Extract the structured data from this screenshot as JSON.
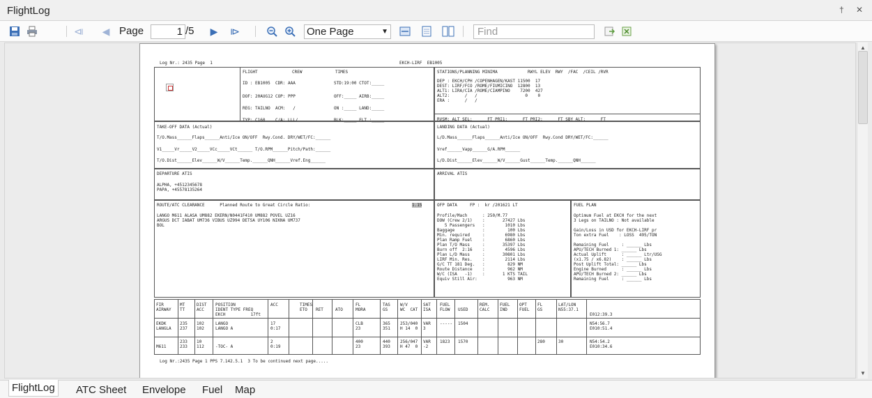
{
  "window": {
    "title": "FlightLog",
    "pin_icon": "pin-icon",
    "close_icon": "close-icon"
  },
  "toolbar": {
    "page_label": "Page",
    "page_value": "1",
    "page_total": "/5",
    "zoom_value": "One Page",
    "find_placeholder": "Find",
    "icons": [
      "save-icon",
      "print-icon",
      "first-page-icon",
      "previous-page-icon",
      "next-page-icon",
      "last-page-icon",
      "zoom-out-icon",
      "zoom-in-icon",
      "page-width-icon",
      "single-page-icon",
      "two-page-icon",
      "export-icon",
      "export-excel-icon"
    ]
  },
  "tabs": [
    "FlightLog",
    "ATC Sheet",
    "Envelope",
    "Fuel",
    "Map"
  ],
  "accent_color": "#2a6fd0",
  "doc": {
    "header_left": "Log Nr.: 2435 Page  1",
    "header_center": "EKCH-LIRF  EB1005",
    "col_flight": "FLIGHT",
    "col_crew": "CREW",
    "col_times": "TIMES",
    "id_line": "ID : EB1005  CDR: AAA",
    "dof_line": "DOF: 20AUG12 COP: PPP",
    "reg_line": "REG: TAILNO  ACM:   /",
    "typ_line": "TYP: C160    C/A: LLL/",
    "std_line": "STD:19:00 CTOT:_____",
    "off_line": "OFF:_____ AIRB:_____",
    "on_line": "ON :_____ LAND:_____",
    "blk_line": "BLK:_____ FLT :_____",
    "stations_hdr": "STATIONS/PLANNING MINIMA            RWYL ELEV  RWY  /FAC  /CEIL /RVR",
    "dep_line": "DEP : EKCH/CPH /COPENHAGEN/KAST 11500  17",
    "dest_line": "DEST: LIRF/FCO /ROME/FIUMICINO  12800  13",
    "alt1_line": "ALT1: LIRA/CIA /ROME/CIAMPINO    7200  427",
    "alt2_line": "ALT2:      /   /                   0    0",
    "era_line": "ERA :      /   /",
    "rvsm_line": "RVSM: ALT SEL:______FT PRI1:______FT PRI2:______FT SBY ALT:______FT",
    "to_hdr": "TAKE-OFF DATA (Actual)",
    "to_l1": "T/O.Mass______Flaps______Anti/Ice ON/OFF  Rwy.Cond. DRY/WET/FC:______",
    "to_l2": "V1_____Vr_____V2_____VCc_____VCt______ T/O.RPM______Pitch/Path:______",
    "to_l3": "T/O.Dist______Elev______W/V______Temp.______QNH______Vref.Eng______",
    "ldg_hdr": "LANDING DATA (Actual)",
    "ldg_l1": "L/D.Mass______Flaps______Anti/Ice ON/OFF  Rwy.Cond DRY/WET/FC:______",
    "ldg_l2": "Vref______Vapp______G/A.RPM______",
    "ldg_l3": "L/D.Dist______Elev______W/V______Gust______Temp.______QNH______",
    "dep_atis_hdr": "DEPARTURE ATIS",
    "dep_atis_l1": "ALPHA, +4512345678",
    "dep_atis_l2": "PAPA, +45578135264",
    "arr_atis_hdr": "ARRIVAL ATIS",
    "route_hdr": "ROUTE/ATC CLEARANCE      Planned Route to Great Circle Ratio:",
    "route_ratio": "1.15",
    "route_l1": "LANGO M611 ALASA UM882 EKERN/N0441F410 UM882 POVEL UZ16",
    "route_l2": "ARGUS DCT IABAT UM736 VIBUS UZ994 DETSA UY106 NIKNA UM737",
    "route_l3": "BOL",
    "ofp_hdr": "OFP DATA     FP :  kr /201621 LT",
    "ofp_lines": [
      "Profile/Mach      : 250/M.77",
      "DOW (Crew 2/1)    :       27427 Lbs",
      "   5 Passengers   :        1010 Lbs",
      "Baggage           :         100 Lbs",
      "Min. required     :        6980 Lbs",
      "Plan Ramp Fuel    :        6860 Lbs",
      "Plan T/O Mass     :       35397 Lbs",
      "Burn off  2:16    :        4596 Lbs",
      "Plan L/D Mass     :       30801 Lbs",
      "LIRF Min. Res.    :        2114 Lbs",
      "G/C TT 181 Deg.   :         829 NM",
      "Route Distance    :         962 NM",
      "W/C (ISA   -1)    :       1 KTS TAIL",
      "Equiv Still Air:            963 NM"
    ],
    "fuel_hdr": "FUEL PLAN",
    "fuel_lines": [
      "Optimum Fuel at EKCH for the next",
      "3 Legs on TAILNO : Not available",
      "",
      "Gain/Loss in USD for EKCH-LIRF pr",
      "Ton extra Fuel    : LOSS  495/TON",
      "",
      "Remaining Fuel     : ______ Lbs",
      "APU/TECH Burned 1: ______ Lbs",
      "Actual Uplift      : ______ Ltr/USG",
      "(x1.75 / x6.82)    : ______ Lbs",
      "Post Uplift Total: ______ Lbs",
      "Engine Burned      : ______ Lbs",
      "APU/TECH Burned 2: ______ Lbs",
      "Remaining Fuel     : ______ Lbs"
    ],
    "table_hdr1": [
      "FIR",
      "MT",
      "DIST",
      "POSITION",
      "ACC",
      "TIMES",
      "",
      "",
      "FL",
      "TAS",
      "W/V",
      "SAT",
      "FUEL",
      "",
      "REM.",
      "FUEL",
      "OPT",
      "FL",
      "LAT/LON"
    ],
    "table_hdr2": [
      "AIRWAY",
      "TT",
      "ACC",
      "IDENT TYPE FREQ",
      "",
      "ETO",
      "RET",
      "ATO",
      "MORA",
      "GS",
      "WC  CAT",
      "ISA",
      "FLOW",
      "USED",
      "CALC",
      "IND",
      "FUEL",
      "GS",
      "N55:37.1"
    ],
    "table_hdr3": "EKCH          17ft",
    "table_hdr3_coord": "E012:39.3",
    "rows": [
      {
        "a": "EKDK\nLANGLA",
        "b": "235\n237",
        "c": "102\n102",
        "d": "LANGO\nLANGO A",
        "e": "17\n0:17",
        "f": "CLB\n23",
        "g": "365\n351",
        "h": "253/040\nH 14  0",
        "i": "VAR\n3",
        "j": "-----",
        "k": "1504",
        "l": "",
        "m": "",
        "n": "N54:56.7\nE010:51.4"
      },
      {
        "a": "\nM611",
        "b": "233\n233",
        "c": "10\n112",
        "d": "\n-TOC- A",
        "e": "2\n0:19",
        "f": "400\n23",
        "g": "440\n393",
        "h": "256/047\nH 47  0",
        "i": "VAR\n-2",
        "j": "1823",
        "k": "1570",
        "l": "280",
        "m": "30",
        "n": "N54:54.2\nE010:34.6"
      }
    ],
    "footer": "Log Nr.:2435 Page 1 PPS 7.142.5.1  3 To be continued next page....."
  }
}
